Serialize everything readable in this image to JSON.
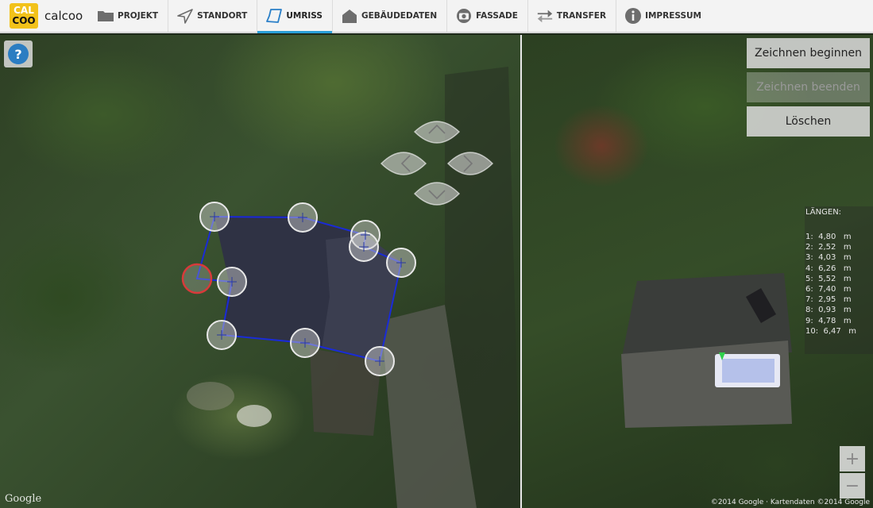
{
  "app": {
    "logo_top": "CAL",
    "logo_bottom": "COO",
    "name": "calcoo"
  },
  "tabs": [
    {
      "label": "PROJEKT",
      "icon": "folder-icon"
    },
    {
      "label": "STANDORT",
      "icon": "location-arrow-icon"
    },
    {
      "label": "UMRISS",
      "icon": "outline-shape-icon",
      "active": true
    },
    {
      "label": "GEBÄUDEDATEN",
      "icon": "house-icon"
    },
    {
      "label": "FASSADE",
      "icon": "camera-icon"
    },
    {
      "label": "TRANSFER",
      "icon": "transfer-arrows-icon"
    },
    {
      "label": "IMPRESSUM",
      "icon": "info-icon"
    }
  ],
  "map": {
    "help_label": "?",
    "google_label": "Google",
    "copyright": "©2014 Google · Kartendaten ©2014 Google",
    "accent_color": "#2a9fd8",
    "polygon_color": "#1a2bd6",
    "selected_vertex_color": "#d83a3a"
  },
  "actions": {
    "start": "Zeichnen beginnen",
    "end": "Zeichnen beenden",
    "delete": "Löschen"
  },
  "lengths": {
    "title": "LÄNGEN:",
    "items": [
      "1:  4,80   m",
      "2:  2,52   m",
      "3:  4,03   m",
      "4:  6,26   m",
      "5:  5,52   m",
      "6:  7,40   m",
      "7:  2,95   m",
      "8:  0,93   m",
      "9:  4,78   m",
      "10:  6,47   m"
    ]
  },
  "zoom": {
    "in": "+",
    "out": "−"
  }
}
